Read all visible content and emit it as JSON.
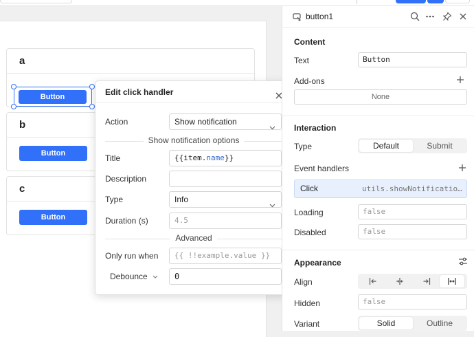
{
  "canvas": {
    "items": [
      {
        "header": "a",
        "button_label": "Button"
      },
      {
        "header": "b",
        "button_label": "Button"
      },
      {
        "header": "c",
        "button_label": "Button"
      }
    ],
    "selected_button_label": "Button"
  },
  "click_handler": {
    "title": "Edit click handler",
    "action_label": "Action",
    "action_value": "Show notification",
    "options_section": "Show notification options",
    "title_label": "Title",
    "title_value_open": "{{",
    "title_value_obj": "item.",
    "title_value_name": "name",
    "title_value_close": "}}",
    "description_label": "Description",
    "description_value": "",
    "type_label": "Type",
    "type_value": "Info",
    "duration_label": "Duration (s)",
    "duration_placeholder": "4.5",
    "advanced_section": "Advanced",
    "only_run_label": "Only run when",
    "only_run_placeholder": "{{ !!example.value }}",
    "debounce_label": "Debounce",
    "debounce_value": "0"
  },
  "inspector": {
    "component_name": "button1",
    "content": {
      "title": "Content",
      "text_label": "Text",
      "text_value": "Button",
      "addons_label": "Add-ons",
      "addons_value": "None"
    },
    "interaction": {
      "title": "Interaction",
      "type_label": "Type",
      "type_options": [
        "Default",
        "Submit"
      ],
      "type_selected": "Default",
      "event_handlers_label": "Event handlers",
      "handler_event": "Click",
      "handler_action": "utils.showNotificatio…",
      "loading_label": "Loading",
      "loading_placeholder": "false",
      "disabled_label": "Disabled",
      "disabled_placeholder": "false"
    },
    "appearance": {
      "title": "Appearance",
      "align_label": "Align",
      "align_selected": "stretch",
      "hidden_label": "Hidden",
      "hidden_placeholder": "false",
      "variant_label": "Variant",
      "variant_options": [
        "Solid",
        "Outline"
      ],
      "variant_selected": "Solid"
    }
  },
  "colors": {
    "accent": "#3170f9",
    "template_green": "#1a9c6b",
    "template_blue": "#3366cc",
    "handler_bg": "#e8f0fe"
  }
}
